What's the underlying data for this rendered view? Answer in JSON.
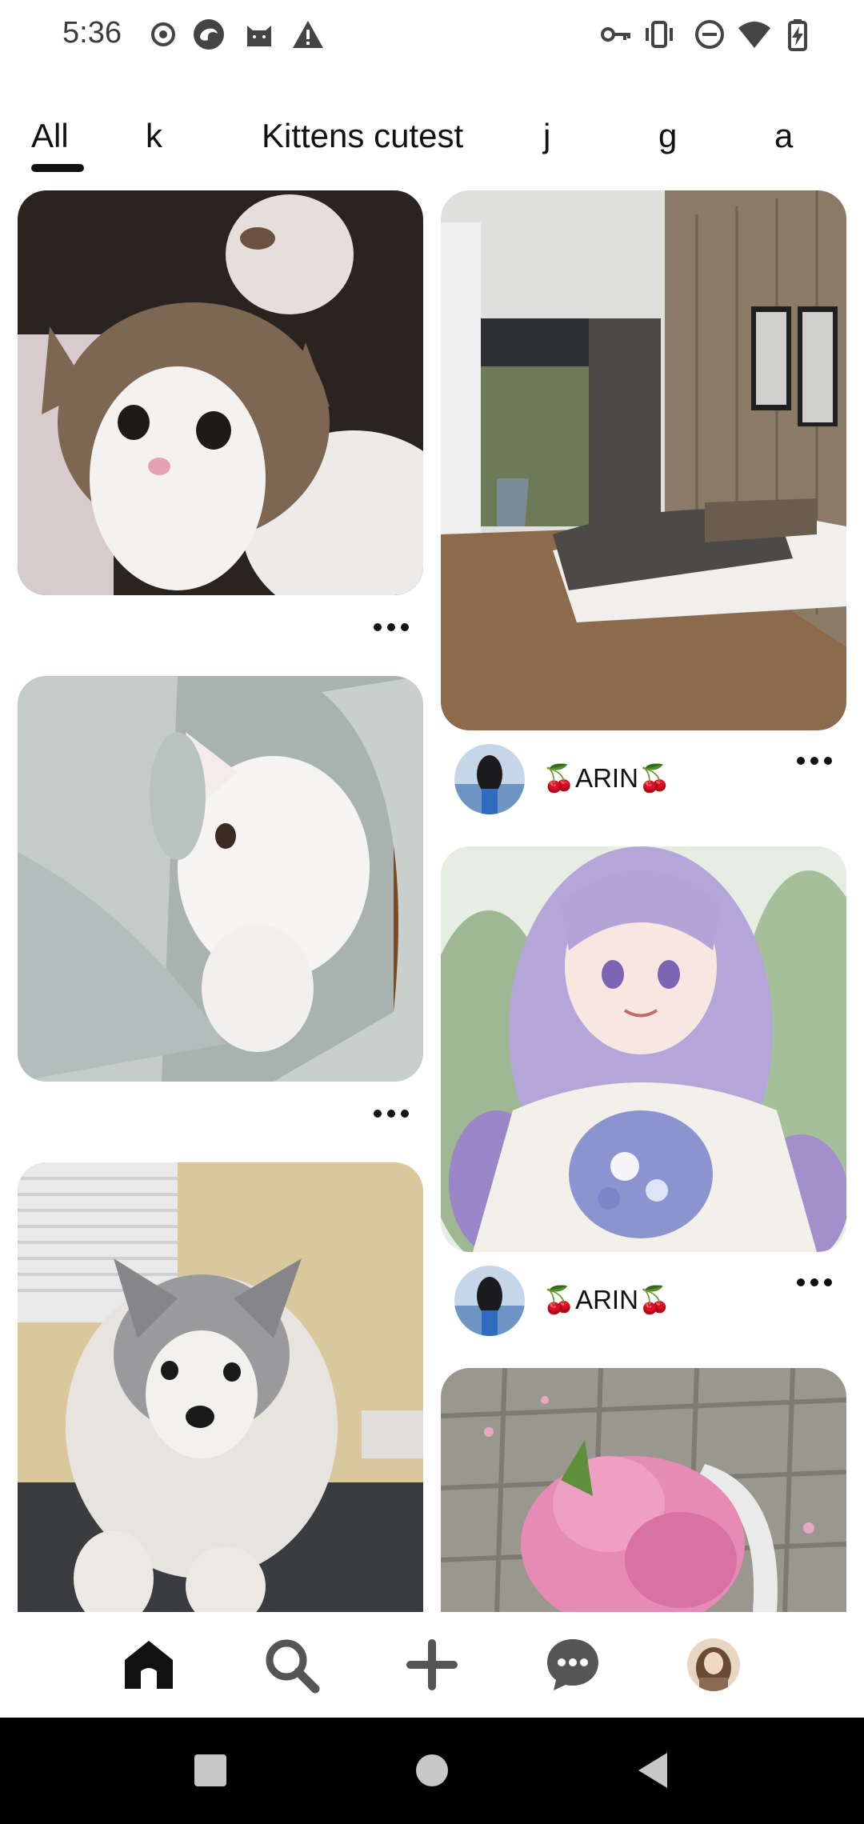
{
  "status_bar": {
    "time": "5:36",
    "left_icons": [
      "record-icon",
      "edge-browser-icon",
      "cat-app-icon",
      "warning-icon"
    ],
    "right_icons": [
      "vpn-key-icon",
      "vibrate-icon",
      "do-not-disturb-icon",
      "wifi-icon",
      "battery-charging-icon"
    ]
  },
  "tabs": [
    {
      "label": "All",
      "selected": true
    },
    {
      "label": "k",
      "selected": false
    },
    {
      "label": "Kittens cutest",
      "selected": false
    },
    {
      "label": "j",
      "selected": false
    },
    {
      "label": "g",
      "selected": false
    },
    {
      "label": "a",
      "selected": false
    }
  ],
  "pins": {
    "kitten_1": {
      "alt": "tabby kitten"
    },
    "bedroom": {
      "alt": "modern bedroom",
      "author": "🍒ARIN🍒"
    },
    "kitten_2": {
      "alt": "white kitten in blanket"
    },
    "anime_girl": {
      "alt": "anime girl with lavender hair",
      "author": "🍒ARIN🍒"
    },
    "puppy": {
      "alt": "fluffy grey puppy"
    },
    "flowers": {
      "alt": "pink flowers on pavement"
    }
  },
  "bottom_nav": [
    "home-icon",
    "search-icon",
    "create-icon",
    "messages-icon",
    "profile-avatar"
  ],
  "colors": {
    "accent": "#111111",
    "background": "#ffffff"
  }
}
